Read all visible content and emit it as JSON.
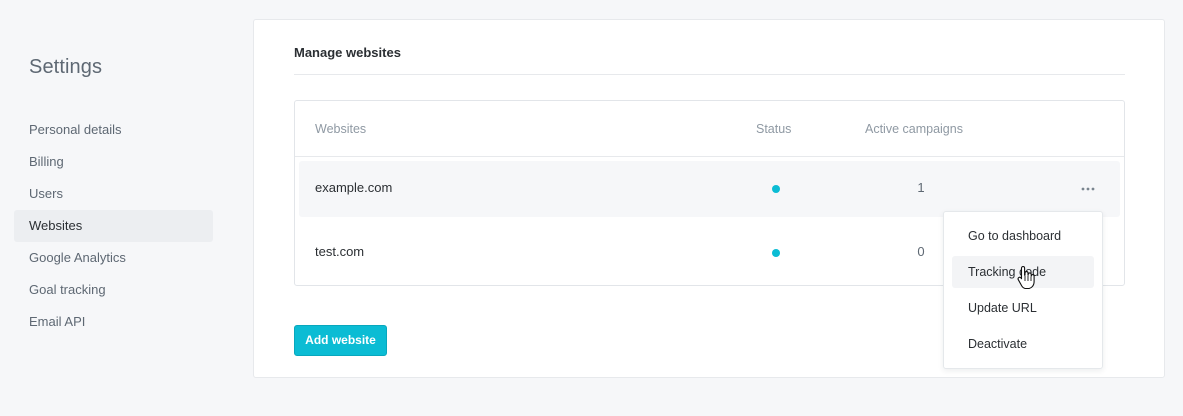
{
  "sidebar": {
    "title": "Settings",
    "items": [
      {
        "label": "Personal details"
      },
      {
        "label": "Billing"
      },
      {
        "label": "Users"
      },
      {
        "label": "Websites",
        "active": true
      },
      {
        "label": "Google Analytics"
      },
      {
        "label": "Goal tracking"
      },
      {
        "label": "Email API"
      }
    ]
  },
  "main": {
    "title": "Manage websites",
    "table": {
      "headers": {
        "websites": "Websites",
        "status": "Status",
        "campaigns": "Active campaigns"
      },
      "rows": [
        {
          "website": "example.com",
          "status": "active",
          "campaigns": "1"
        },
        {
          "website": "test.com",
          "status": "active",
          "campaigns": "0"
        }
      ]
    },
    "add_button_label": "Add website"
  },
  "menu": {
    "items": [
      {
        "label": "Go to dashboard"
      },
      {
        "label": "Tracking code"
      },
      {
        "label": "Update URL"
      },
      {
        "label": "Deactivate"
      }
    ]
  },
  "colors": {
    "accent": "#0bbcd4",
    "status_active": "#0bbcd4"
  },
  "icons": {
    "row_actions": "more-horizontal-icon",
    "cursor": "hand-pointer-icon"
  }
}
